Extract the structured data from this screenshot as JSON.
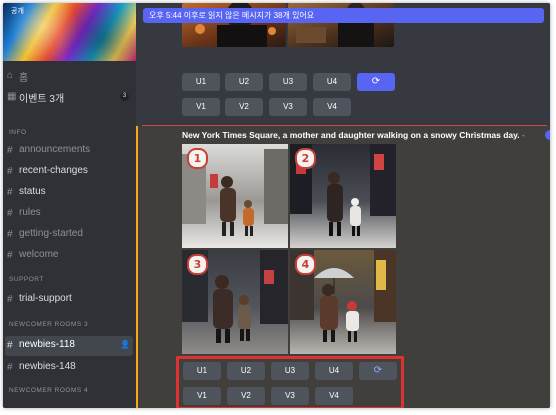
{
  "server": {
    "name": "공개"
  },
  "banner": {
    "text": "오후 5:44 이후로 읽지 않은 메시지가 38개 있어요"
  },
  "sidebar": {
    "item_top": "홈",
    "events": {
      "label": "이벤트 3개",
      "count": "3"
    },
    "category_info": "INFO",
    "channels_info": [
      "announcements",
      "recent-changes",
      "status",
      "rules",
      "getting-started",
      "welcome"
    ],
    "category_support": "SUPPORT",
    "channels_support": [
      "trial-support"
    ],
    "category_newcomer3": "NEWCOMER ROOMS 3",
    "channels_newcomer3": [
      "newbies-118",
      "newbies-148"
    ],
    "category_newcomer4": "NEWCOMER ROOMS 4"
  },
  "message_prev": {
    "upscale_buttons": [
      "U1",
      "U2",
      "U3",
      "U4"
    ],
    "variation_buttons": [
      "V1",
      "V2",
      "V3",
      "V4"
    ],
    "refresh_icon": "refresh-icon"
  },
  "message": {
    "prompt": "New York Times Square, a mother and daughter walking on a snowy Christmas day.",
    "dash": "-",
    "grid_numbers": [
      "1",
      "2",
      "3",
      "4"
    ],
    "upscale_buttons": [
      "U1",
      "U2",
      "U3",
      "U4"
    ],
    "variation_buttons": [
      "V1",
      "V2",
      "V3",
      "V4"
    ],
    "refresh_icon": "refresh-icon"
  },
  "colors": {
    "accent": "#5865f2",
    "highlight_box": "#e03131",
    "mention_bar": "#faa81a"
  }
}
